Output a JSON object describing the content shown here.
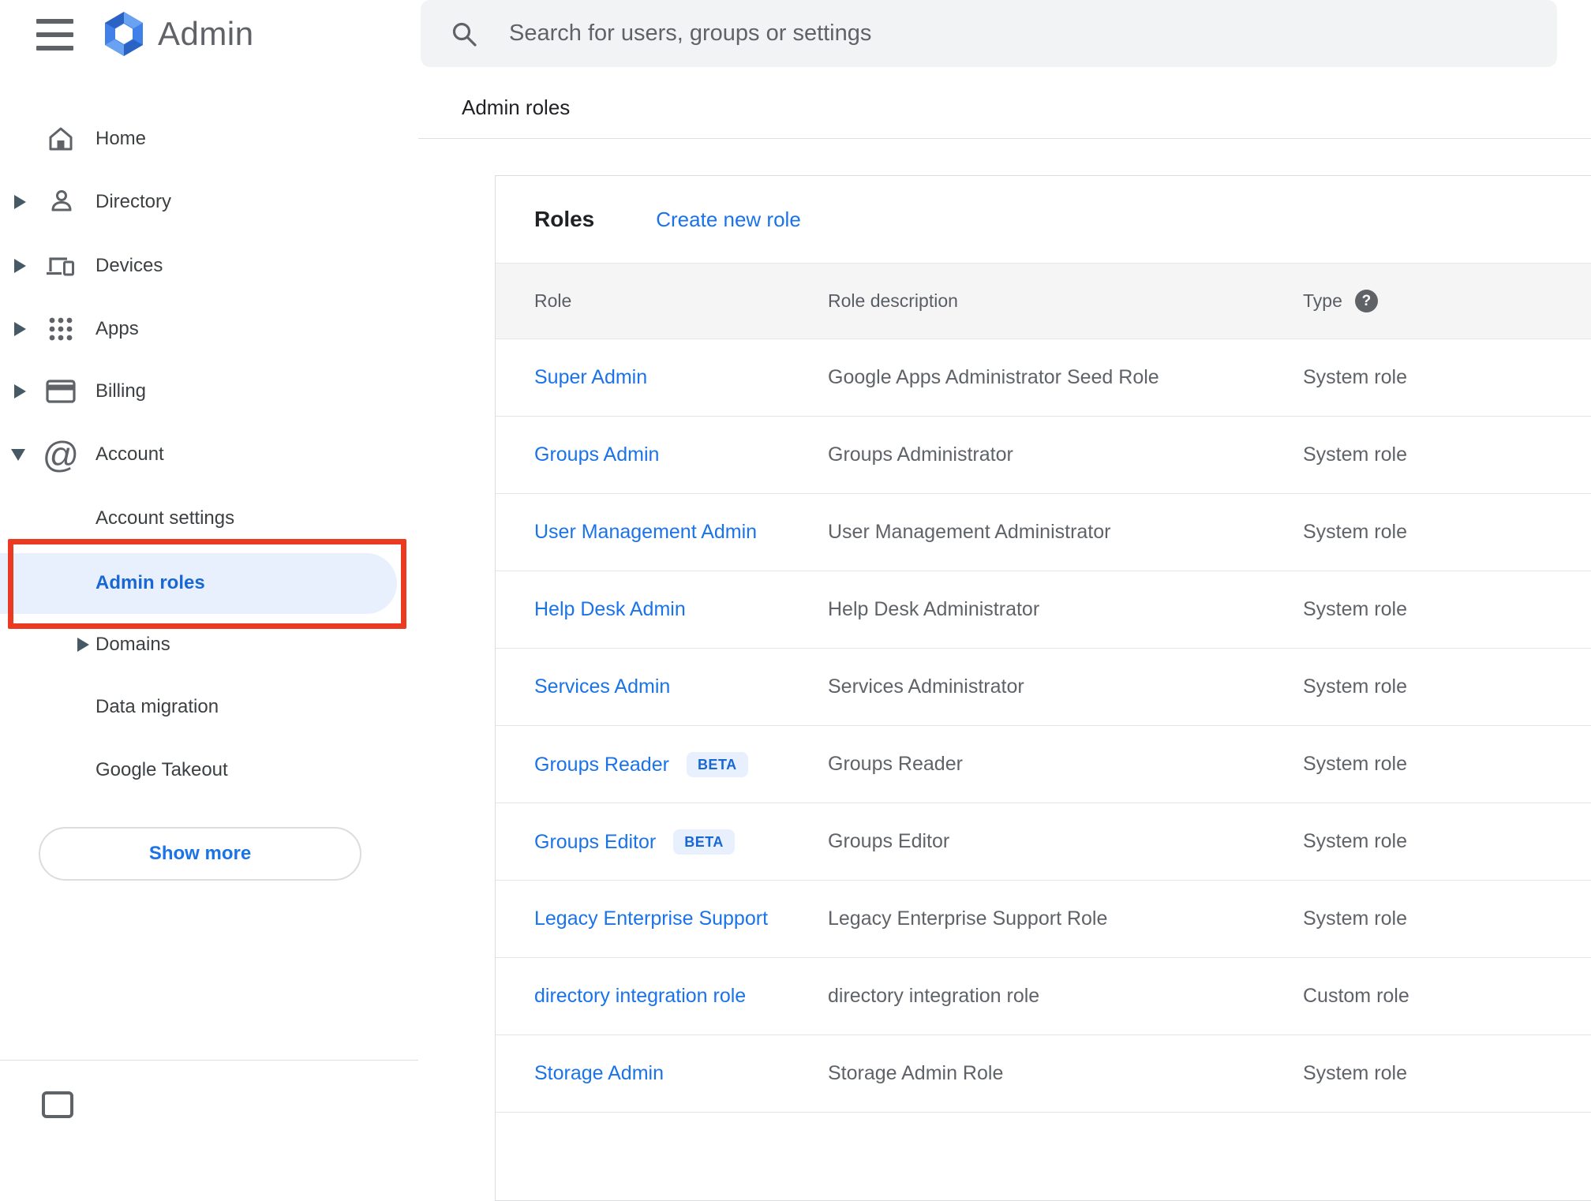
{
  "header": {
    "app_name": "Admin",
    "menu_icon": "hamburger-icon",
    "logo_icon": "google-admin-hexagon-logo"
  },
  "search": {
    "icon": "search-icon",
    "placeholder": "Search for users, groups or settings"
  },
  "breadcrumb": {
    "label": "Admin roles"
  },
  "sidebar": {
    "items": [
      {
        "label": "Home",
        "icon": "home-icon",
        "expander": "none"
      },
      {
        "label": "Directory",
        "icon": "person-icon",
        "expander": "collapsed"
      },
      {
        "label": "Devices",
        "icon": "devices-icon",
        "expander": "collapsed"
      },
      {
        "label": "Apps",
        "icon": "apps-grid-icon",
        "expander": "collapsed"
      },
      {
        "label": "Billing",
        "icon": "credit-card-icon",
        "expander": "collapsed"
      },
      {
        "label": "Account",
        "icon": "at-sign-icon",
        "expander": "expanded"
      }
    ],
    "account_sub_items": [
      {
        "label": "Account settings",
        "selected": false
      },
      {
        "label": "Admin roles",
        "selected": true
      },
      {
        "label": "Domains",
        "expander": "collapsed",
        "selected": false
      },
      {
        "label": "Data migration",
        "selected": false
      },
      {
        "label": "Google Takeout",
        "selected": false
      }
    ],
    "show_more_label": "Show more"
  },
  "annotation": {
    "shape": "red-highlight-box",
    "target": "Admin roles sidebar item",
    "color": "#ea3b22"
  },
  "roles_panel": {
    "title": "Roles",
    "create_new_role_label": "Create new role",
    "table": {
      "columns": {
        "role": "Role",
        "description": "Role description",
        "type": "Type"
      },
      "type_help_icon": "question-mark-circle-icon",
      "type_help_glyph": "?",
      "rows": [
        {
          "role": "Super Admin",
          "description": "Google Apps Administrator Seed Role",
          "type": "System role"
        },
        {
          "role": "Groups Admin",
          "description": "Groups Administrator",
          "type": "System role"
        },
        {
          "role": "User Management Admin",
          "description": "User Management Administrator",
          "type": "System role"
        },
        {
          "role": "Help Desk Admin",
          "description": "Help Desk Administrator",
          "type": "System role"
        },
        {
          "role": "Services Admin",
          "description": "Services Administrator",
          "type": "System role"
        },
        {
          "role": "Groups Reader",
          "beta_label": "BETA",
          "description": "Groups Reader",
          "type": "System role"
        },
        {
          "role": "Groups Editor",
          "beta_label": "BETA",
          "description": "Groups Editor",
          "type": "System role"
        },
        {
          "role": "Legacy Enterprise Support",
          "description": "Legacy Enterprise Support Role",
          "type": "System role"
        },
        {
          "role": "directory integration role",
          "description": "directory integration role",
          "type": "Custom role"
        },
        {
          "role": "Storage Admin",
          "description": "Storage Admin Role",
          "type": "System role"
        }
      ]
    }
  },
  "colors": {
    "link_blue": "#1a73e8",
    "selected_item_blue": "#1967d2",
    "selected_pill_bg": "#e8f0fe",
    "beta_badge_bg": "#e8f0fe",
    "beta_badge_text": "#1967d2",
    "annotation_red": "#ea3b22",
    "icon_gray": "#5f6368",
    "logo_blue": "#4080e8",
    "table_header_bg": "#f5f5f6",
    "search_bg": "#f1f3f4"
  }
}
